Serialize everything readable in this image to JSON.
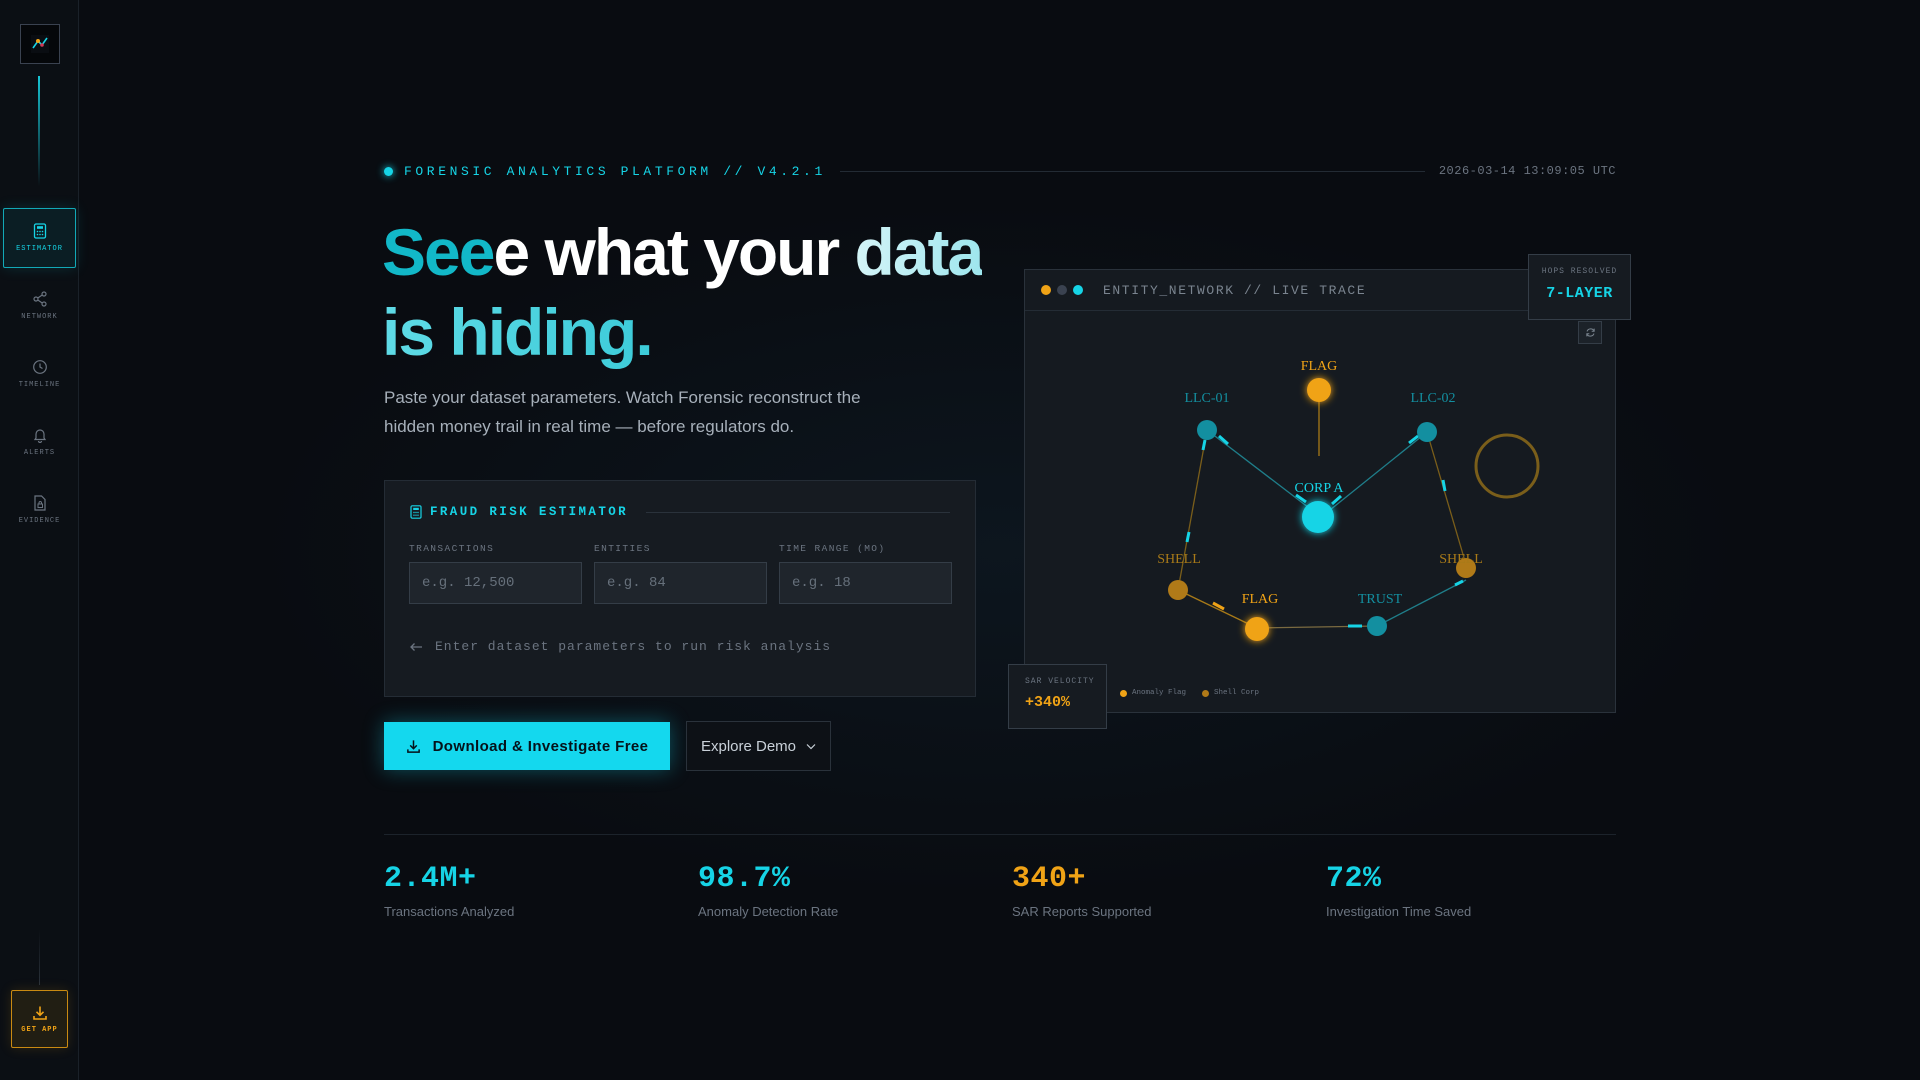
{
  "sidebar": {
    "items": [
      {
        "label": "ESTIMATOR",
        "icon": "calculator-icon",
        "active": true
      },
      {
        "label": "NETWORK",
        "icon": "share-icon"
      },
      {
        "label": "TIMELINE",
        "icon": "clock-icon"
      },
      {
        "label": "ALERTS",
        "icon": "bell-icon"
      },
      {
        "label": "EVIDENCE",
        "icon": "file-lock-icon"
      }
    ],
    "get_app_label": "GET APP"
  },
  "header": {
    "platform": "FORENSIC ANALYTICS PLATFORM // V4.2.1",
    "timestamp": "2026-03-14 13:09:05 UTC"
  },
  "hero": {
    "part_cyan": "See",
    "part_white": "e what your",
    "part_pale": "data",
    "line2": "is hiding.",
    "subtitle": "Paste your dataset parameters. Watch Forensic reconstruct the hidden money trail in real time — before regulators do."
  },
  "estimator": {
    "title": "FRAUD RISK ESTIMATOR",
    "fields": [
      {
        "label": "TRANSACTIONS",
        "placeholder": "e.g. 12,500"
      },
      {
        "label": "ENTITIES",
        "placeholder": "e.g. 84"
      },
      {
        "label": "TIME RANGE (MO)",
        "placeholder": "e.g. 18"
      }
    ],
    "hint": "Enter dataset parameters to run risk analysis"
  },
  "actions": {
    "primary": "Download & Investigate Free",
    "secondary": "Explore Demo"
  },
  "network": {
    "title": "ENTITY_NETWORK // LIVE TRACE",
    "window_dot_colors": [
      "#f0a316",
      "#3a4250",
      "#16d4e6"
    ],
    "node_labels": {
      "flag_top": "FLAG",
      "llc01": "LLC-01",
      "llc02": "LLC-02",
      "corp": "CORP A",
      "shell_left": "SHELL",
      "shell_right": "SHELL",
      "flag_bottom": "FLAG",
      "trust": "TRUST"
    },
    "hops_label": "HOPS RESOLVED",
    "hops_value": "7-LAYER",
    "sar_label": "SAR VELOCITY",
    "sar_value": "+340%",
    "legend": [
      {
        "label": "Anomaly Flag",
        "color": "#f0a316"
      },
      {
        "label": "Shell Corp",
        "color": "#b07a18"
      }
    ]
  },
  "stats": [
    {
      "value": "2.4M+",
      "label": "Transactions Analyzed",
      "color": "#16d4e6"
    },
    {
      "value": "98.7%",
      "label": "Anomaly Detection Rate",
      "color": "#16d4e6"
    },
    {
      "value": "340+",
      "label": "SAR Reports Supported",
      "color": "#f0a316"
    },
    {
      "value": "72%",
      "label": "Investigation Time Saved",
      "color": "#16d4e6"
    }
  ],
  "colors": {
    "accent": "#16d4e6",
    "warning": "#f0a316",
    "background": "#090c11"
  }
}
